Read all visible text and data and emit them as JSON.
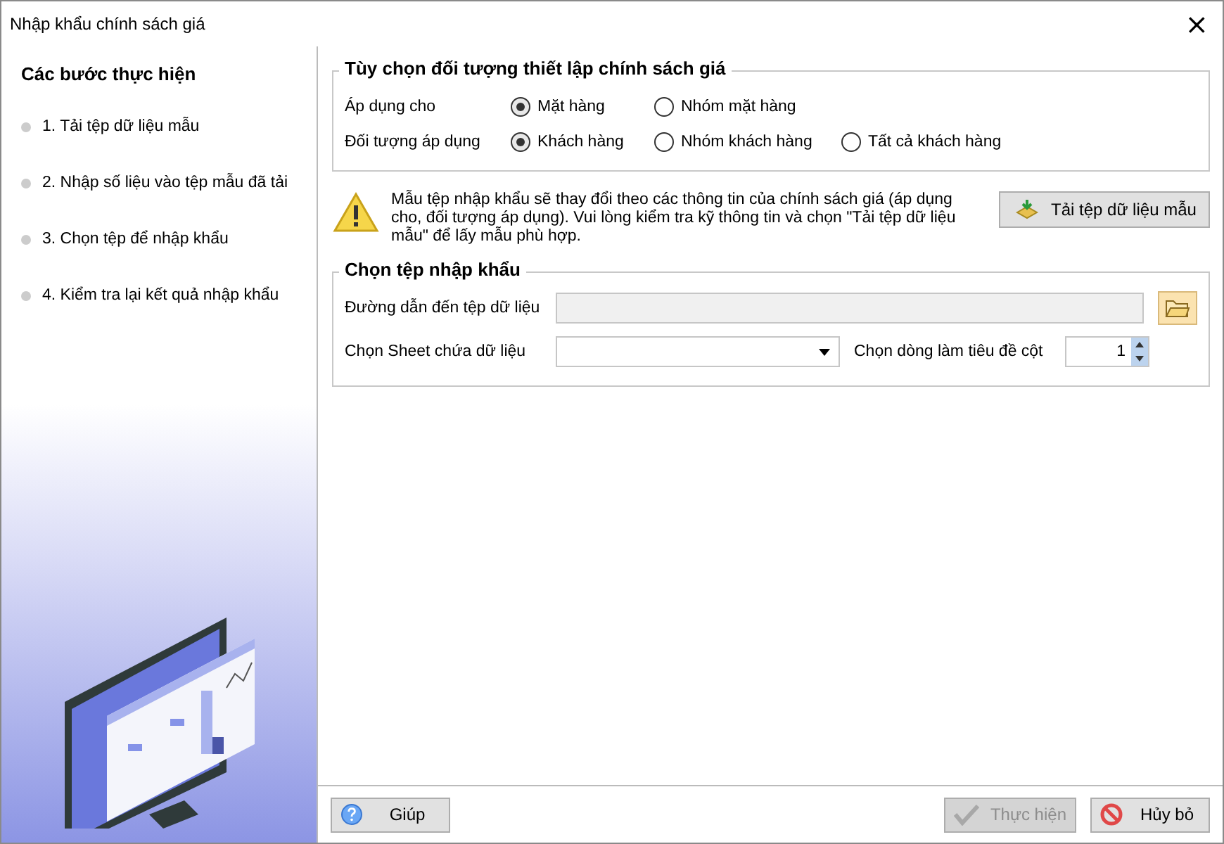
{
  "window": {
    "title": "Nhập khẩu chính sách giá",
    "close": "×"
  },
  "sidebar": {
    "title": "Các bước thực hiện",
    "steps": [
      {
        "label": "1. Tải tệp dữ liệu mẫu"
      },
      {
        "label": "2. Nhập số liệu vào tệp mẫu đã tải"
      },
      {
        "label": "3. Chọn tệp để nhập khẩu"
      },
      {
        "label": "4. Kiểm tra lại kết quả nhập khẩu"
      }
    ]
  },
  "options": {
    "title": "Tùy chọn đối tượng thiết lập chính sách giá",
    "rows": [
      {
        "label": "Áp dụng cho",
        "choices": [
          {
            "label": "Mặt hàng",
            "selected": true
          },
          {
            "label": "Nhóm mặt hàng",
            "selected": false
          }
        ]
      },
      {
        "label": "Đối tượng áp dụng",
        "choices": [
          {
            "label": "Khách hàng",
            "selected": true
          },
          {
            "label": "Nhóm khách hàng",
            "selected": false
          },
          {
            "label": "Tất cả khách hàng",
            "selected": false
          }
        ]
      }
    ]
  },
  "notice": {
    "text": "Mẫu tệp nhập khẩu sẽ thay đổi theo các thông tin của chính sách giá (áp dụng cho, đối tượng áp dụng). Vui lòng kiểm tra kỹ thông tin và chọn \"Tải tệp dữ liệu mẫu\" để lấy mẫu phù hợp.",
    "button": "Tải tệp dữ liệu mẫu"
  },
  "file": {
    "title": "Chọn tệp nhập khẩu",
    "path_label": "Đường dẫn đến tệp dữ liệu",
    "sheet_label": "Chọn Sheet chứa dữ liệu",
    "header_row_label": "Chọn dòng làm tiêu đề cột",
    "header_row": "1"
  },
  "footer": {
    "buttons": [
      {
        "label": "Giúp",
        "kind": "help",
        "disabled": false
      },
      {
        "label": "Thực hiện",
        "kind": "run",
        "disabled": true
      },
      {
        "label": "Hủy bỏ",
        "kind": "cancel",
        "disabled": false
      }
    ]
  }
}
